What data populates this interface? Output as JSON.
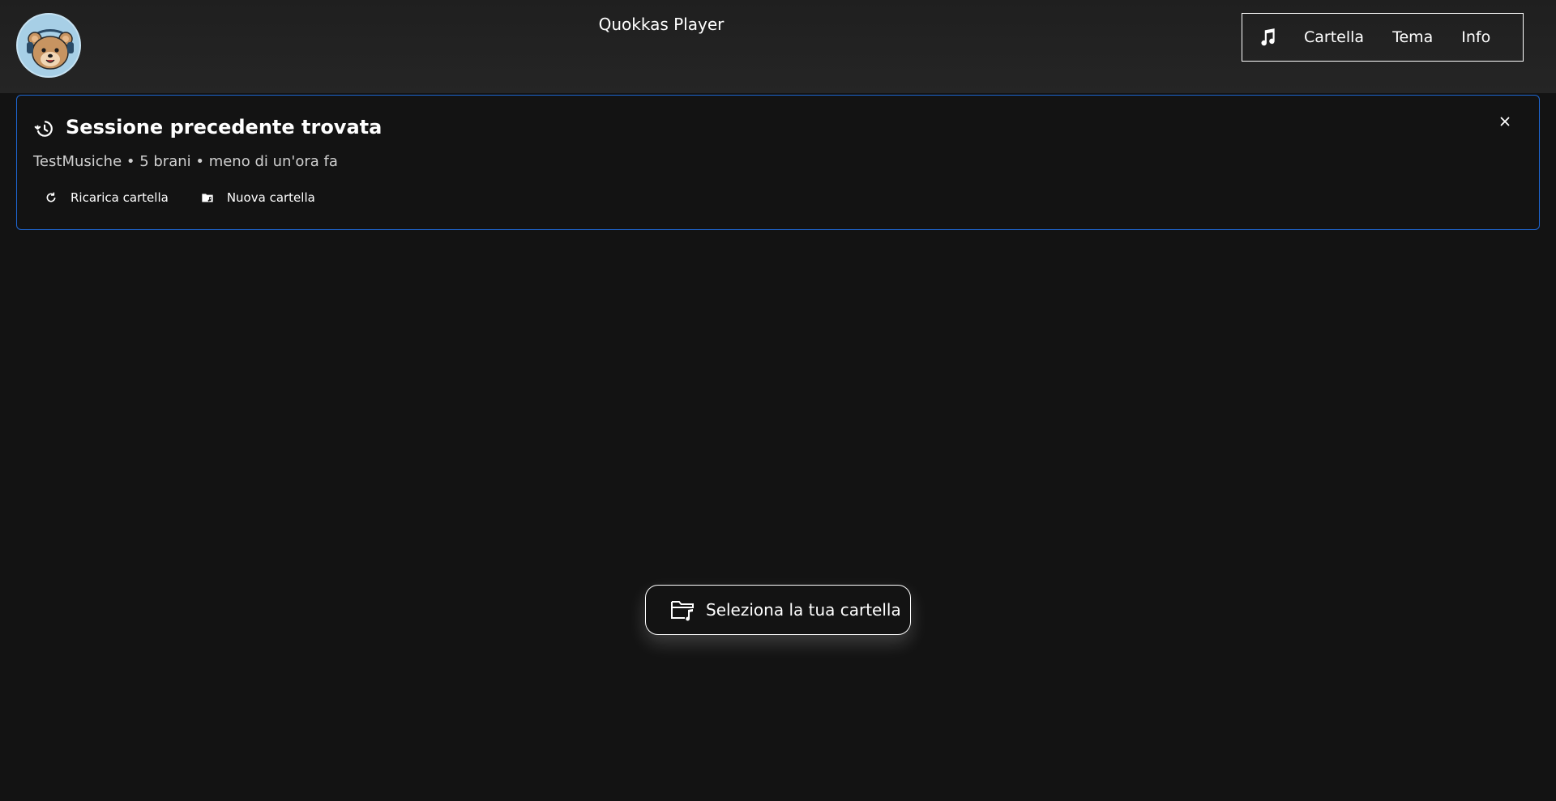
{
  "app": {
    "title": "Quokkas Player"
  },
  "nav": {
    "icon": "music-note-icon",
    "items": [
      {
        "label": "Cartella"
      },
      {
        "label": "Tema"
      },
      {
        "label": "Info"
      }
    ]
  },
  "session": {
    "icon": "history-icon",
    "title": "Sessione precedente trovata",
    "info": "TestMusiche • 5 brani • meno di un'ora fa",
    "actions": [
      {
        "label": "Ricarica cartella",
        "icon": "reload-icon"
      },
      {
        "label": "Nuova cartella",
        "icon": "folder-music-icon"
      }
    ],
    "close_icon": "close-icon",
    "accent_color": "#1e66d0"
  },
  "main": {
    "select_folder_label": "Seleziona la tua cartella",
    "select_folder_icon": "folder-music-icon"
  },
  "colors": {
    "background": "#131313",
    "topbar": "#232323",
    "logo_background": "#a7cfe6"
  }
}
